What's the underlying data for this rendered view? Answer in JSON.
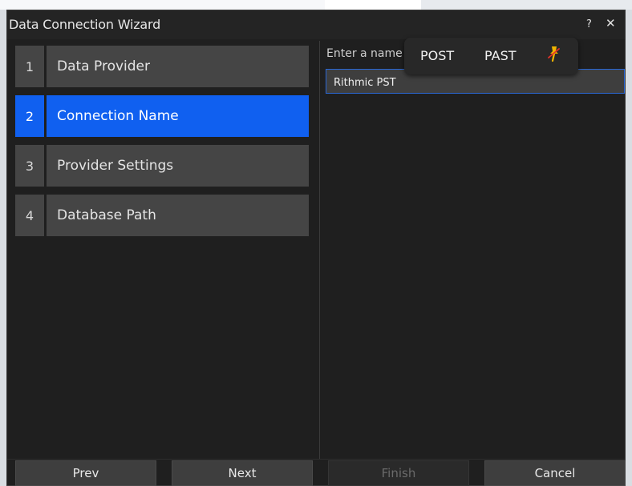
{
  "window": {
    "title": "Data Connection Wizard",
    "help_label": "?",
    "close_label": "✕"
  },
  "steps": [
    {
      "num": "1",
      "label": "Data Provider",
      "active": false
    },
    {
      "num": "2",
      "label": "Connection Name",
      "active": true
    },
    {
      "num": "3",
      "label": "Provider Settings",
      "active": false
    },
    {
      "num": "4",
      "label": "Database Path",
      "active": false
    }
  ],
  "main": {
    "prompt_label": "Enter a name",
    "name_value": "Rithmic PST"
  },
  "popup": {
    "option_1": "POST",
    "option_2": "PAST",
    "pin_icon": "pin-off-icon",
    "pin_color": "#f0b400",
    "pin_slash_color": "#e8322a"
  },
  "footer": {
    "prev_label": "Prev",
    "next_label": "Next",
    "finish_label": "Finish",
    "cancel_label": "Cancel"
  },
  "colors": {
    "accent": "#1060f0",
    "window_bg": "#1f1f1f",
    "panel_bg": "#454545"
  }
}
